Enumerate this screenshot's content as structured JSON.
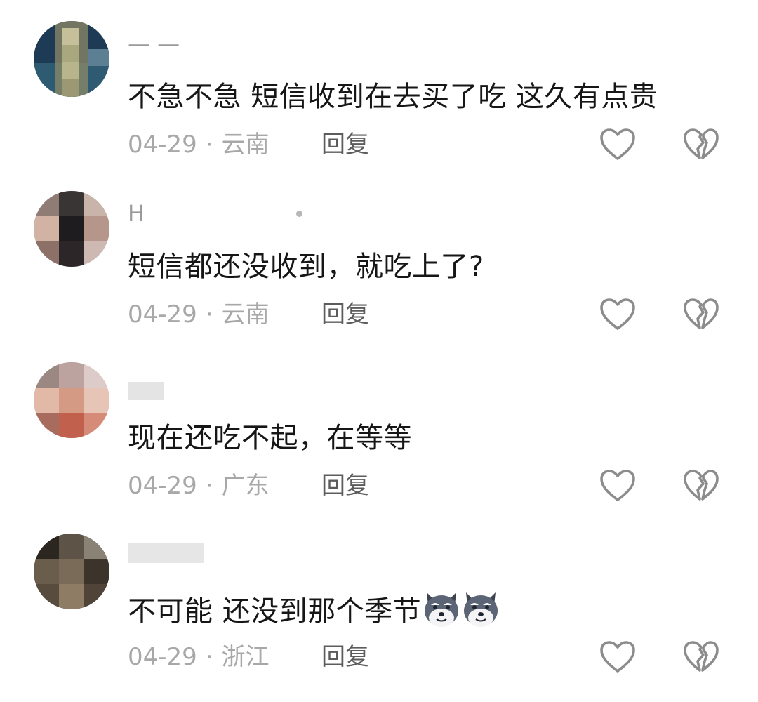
{
  "comments": [
    {
      "username": "— —",
      "text": "不急不急  短信收到在去买了吃 这久有点贵",
      "date": "04-29",
      "separator": "·",
      "location": "云南",
      "reply_label": "回复",
      "avatar": "blurred-avatar",
      "emoji_count": 0
    },
    {
      "username": "H",
      "text": "短信都还没收到，就吃上了?",
      "date": "04-29",
      "separator": "·",
      "location": "云南",
      "reply_label": "回复",
      "avatar": "blurred-avatar",
      "emoji_count": 0
    },
    {
      "username": "",
      "text": "现在还吃不起，在等等",
      "date": "04-29",
      "separator": "·",
      "location": "广东",
      "reply_label": "回复",
      "avatar": "blurred-avatar",
      "emoji_count": 0
    },
    {
      "username": "",
      "text": "不可能  还没到那个季节",
      "date": "04-29",
      "separator": "·",
      "location": "浙江",
      "reply_label": "回复",
      "avatar": "blurred-avatar",
      "emoji": "husky-emoji",
      "emoji_count": 2
    }
  ],
  "icons": {
    "like": "heart-icon",
    "dislike": "broken-heart-icon"
  },
  "colors": {
    "text": "#161616",
    "meta": "#a8a8a8",
    "reply": "#5c5c5c",
    "icon": "#8c8c8c"
  }
}
